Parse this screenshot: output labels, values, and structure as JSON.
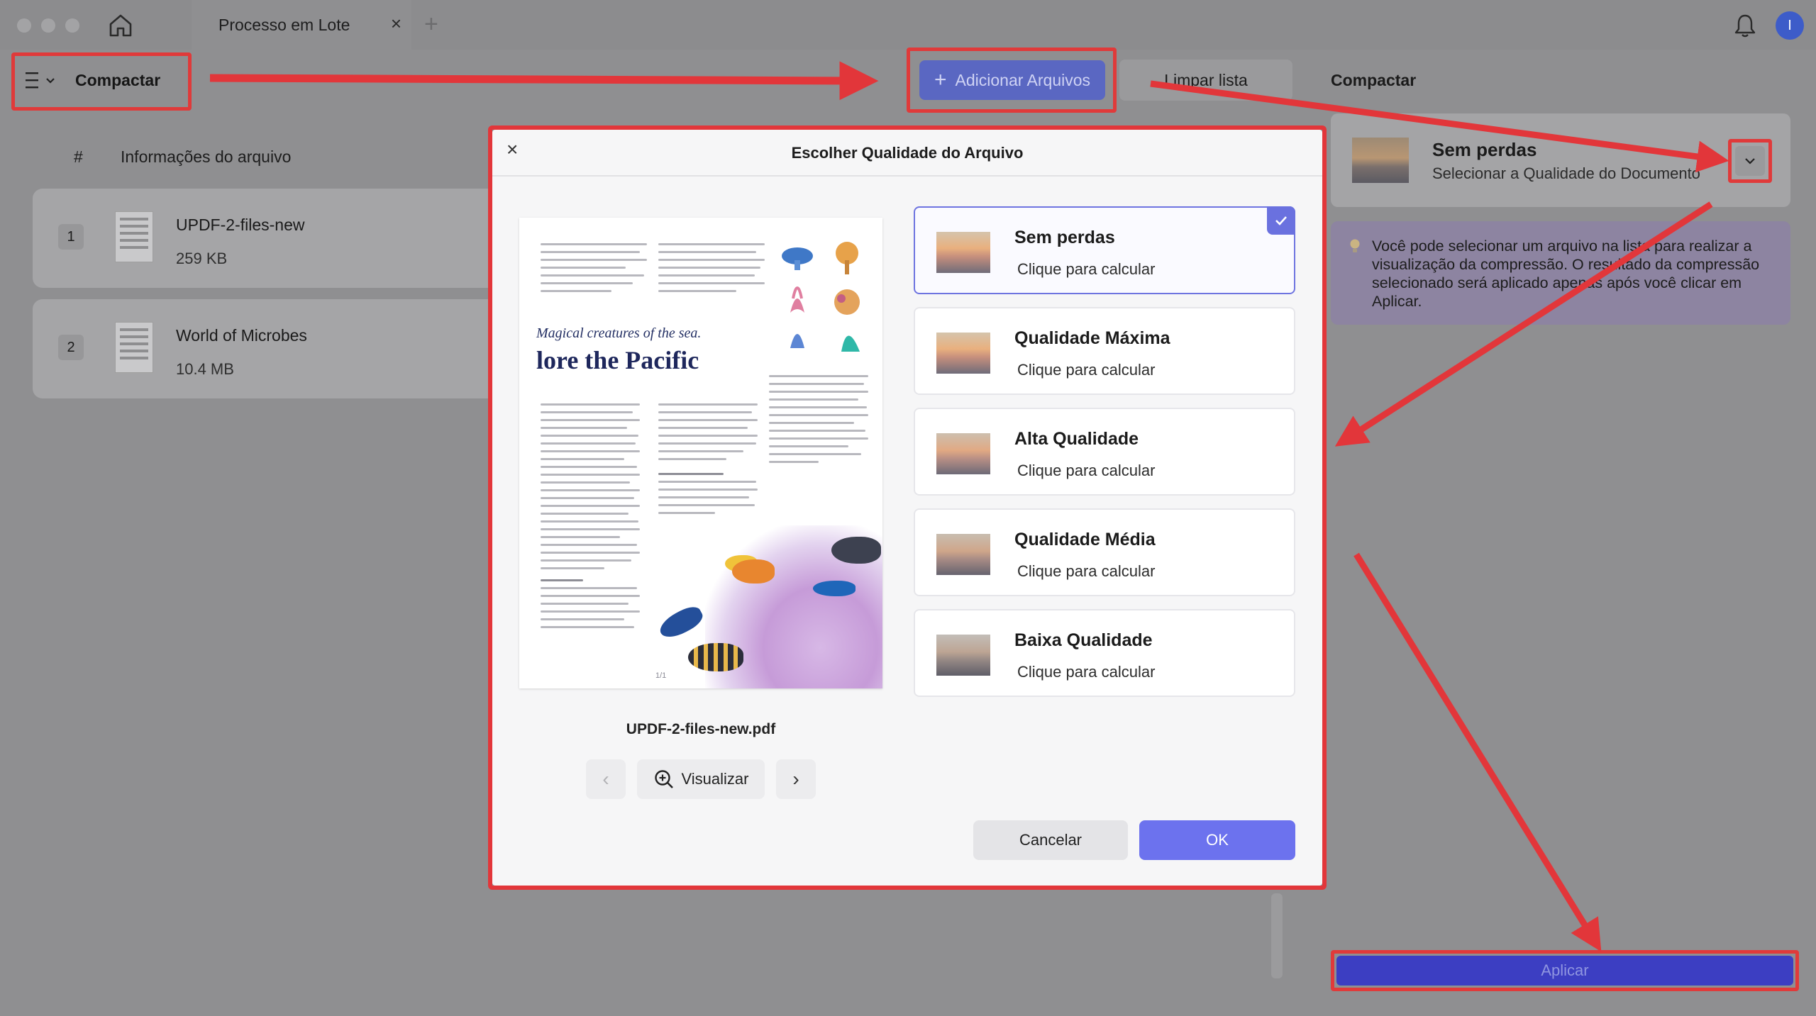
{
  "window": {
    "tab_title": "Processo em Lote",
    "tab_close": "×",
    "tab_add": "+",
    "avatar_initial": "I"
  },
  "toolbar": {
    "mode_label": "Compactar",
    "add_files_plus": "+",
    "add_files_label": "Adicionar Arquivos",
    "clear_list_label": "Limpar lista"
  },
  "file_list": {
    "header_number": "#",
    "header_info": "Informações do arquivo",
    "rows": [
      {
        "number": "1",
        "name": "UPDF-2-files-new",
        "size": "259 KB"
      },
      {
        "number": "2",
        "name": "World of Microbes",
        "size": "10.4 MB"
      }
    ]
  },
  "right_panel": {
    "title": "Compactar",
    "quality_title": "Sem perdas",
    "quality_subtitle": "Selecionar a Qualidade do Documento",
    "info_text": "Você pode selecionar um arquivo na lista para realizar a visualização da compressão. O resultado da compressão selecionado será aplicado apenas após você clicar em Aplicar.",
    "apply_label": "Aplicar"
  },
  "modal": {
    "close": "×",
    "title": "Escolher Qualidade do Arquivo",
    "preview_subtitle": "Magical creatures of the sea.",
    "preview_heading": "lore the Pacific",
    "preview_page": "1/1",
    "file_name": "UPDF-2-files-new.pdf",
    "prev_glyph": "‹",
    "next_glyph": "›",
    "preview_label": "Visualizar",
    "options": [
      {
        "title": "Sem perdas",
        "subtitle": "Clique para calcular",
        "selected": true
      },
      {
        "title": "Qualidade Máxima",
        "subtitle": "Clique para calcular",
        "selected": false
      },
      {
        "title": "Alta Qualidade",
        "subtitle": "Clique para calcular",
        "selected": false
      },
      {
        "title": "Qualidade Média",
        "subtitle": "Clique para calcular",
        "selected": false
      },
      {
        "title": "Baixa Qualidade",
        "subtitle": "Clique para calcular",
        "selected": false
      }
    ],
    "cancel_label": "Cancelar",
    "ok_label": "OK"
  },
  "colors": {
    "accent": "#6c72ee",
    "annotation_red": "#e2363a",
    "apply_button": "#3c3ec2"
  },
  "icons": {
    "home": "home-icon",
    "menu": "menu-icon",
    "bell": "bell-icon",
    "dropdown": "chevron-down-icon",
    "info": "lightbulb-icon",
    "zoom": "zoom-in-icon",
    "check": "check-icon"
  }
}
